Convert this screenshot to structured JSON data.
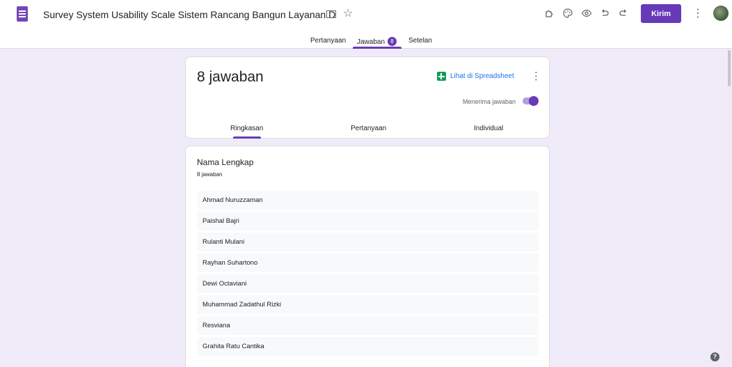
{
  "header": {
    "title": "Survey System Usability Scale Sistem Rancang Bangun Layanan Desa di Ka",
    "send_label": "Kirim",
    "icons": [
      "forms-app-icon",
      "folder-icon",
      "star-icon",
      "addon-icon",
      "palette-icon",
      "preview-eye-icon",
      "undo-icon",
      "redo-icon",
      "more-vert-icon",
      "avatar"
    ]
  },
  "tabs": [
    {
      "label": "Pertanyaan"
    },
    {
      "label": "Jawaban",
      "count": "8",
      "active": true
    },
    {
      "label": "Setelan"
    }
  ],
  "summary": {
    "title": "8 jawaban",
    "sheets_label": "Lihat di Spreadsheet",
    "accepting_label": "Menerima jawaban",
    "accepting": true,
    "sub_tabs": [
      {
        "label": "Ringkasan",
        "active": true
      },
      {
        "label": "Pertanyaan"
      },
      {
        "label": "Individual"
      }
    ]
  },
  "question": {
    "title": "Nama Lengkap",
    "count": "8 jawaban",
    "answers": [
      "Ahmad Nuruzzaman",
      "Paishal Bajri",
      "Rulanti Mulani",
      "Rayhan Suhartono",
      "Dewi Octaviani",
      "Muhammad Zadathul Rizki",
      "Resviana",
      "Grahita Ratu Cantika"
    ]
  },
  "help_glyph": "?",
  "colors": {
    "accent": "#673ab7",
    "background": "#efebf8",
    "link": "#1a73e8",
    "sheets": "#0f9d58"
  }
}
